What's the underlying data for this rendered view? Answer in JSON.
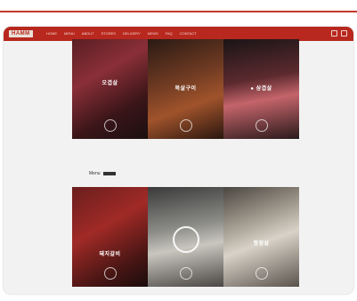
{
  "nav": {
    "logo": "HAMM",
    "items": [
      "HOME",
      "MENU",
      "ABOUT",
      "STORES",
      "DELIVERY",
      "NEWS",
      "FAQ",
      "CONTACT"
    ]
  },
  "hero_top": {
    "panels": [
      {
        "label": "오겹살",
        "sub": ""
      },
      {
        "label": "목살구이",
        "sub": ""
      },
      {
        "label": "● 삼겹살",
        "sub": ""
      }
    ]
  },
  "section": {
    "label": "Menu"
  },
  "hero_bottom": {
    "panels": [
      {
        "label": "돼지갈비",
        "sub": ""
      },
      {
        "label": "",
        "sub": ""
      },
      {
        "label": "항정살",
        "sub": ""
      }
    ]
  },
  "colors": {
    "brand": "#b8281e",
    "accent": "#c43a2b"
  }
}
